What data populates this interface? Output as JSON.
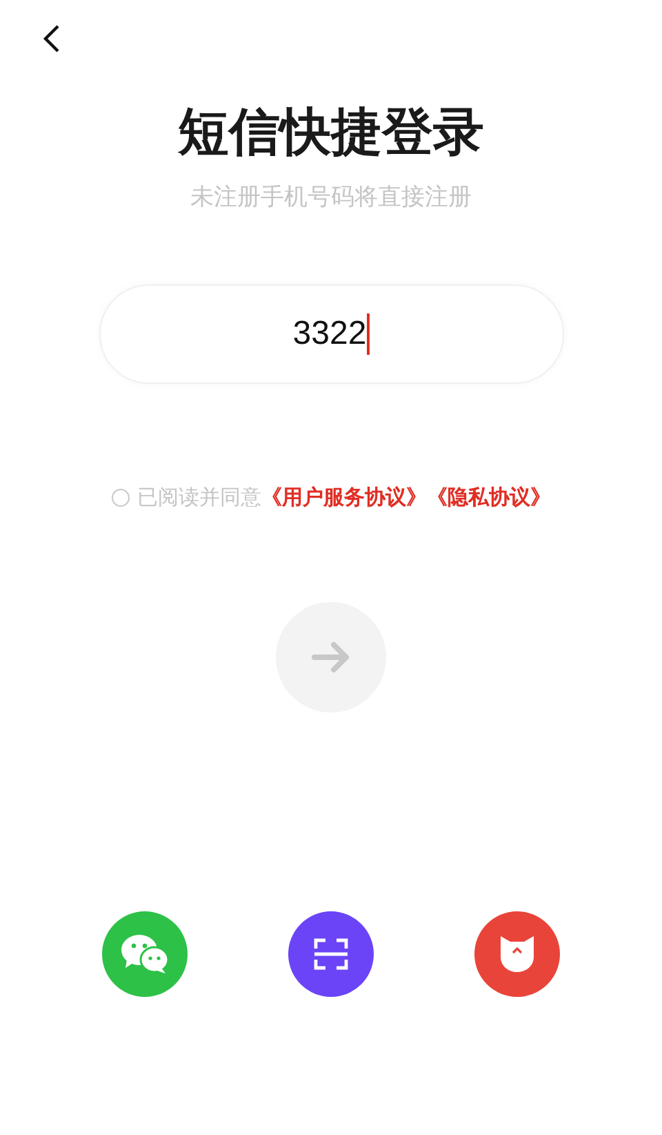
{
  "title": "短信快捷登录",
  "subtitle": "未注册手机号码将直接注册",
  "phone_field": {
    "value": "3322",
    "focused": true
  },
  "agreement": {
    "checked": false,
    "text": "已阅读并同意",
    "links": [
      "《用户服务协议》",
      "《隐私协议》"
    ]
  },
  "submit": {
    "disabled": true
  },
  "login_options": [
    {
      "kind": "chat",
      "color": "#2dc147"
    },
    {
      "kind": "scan",
      "color": "#6a44f6"
    },
    {
      "kind": "cat",
      "color": "#e9443a"
    }
  ]
}
